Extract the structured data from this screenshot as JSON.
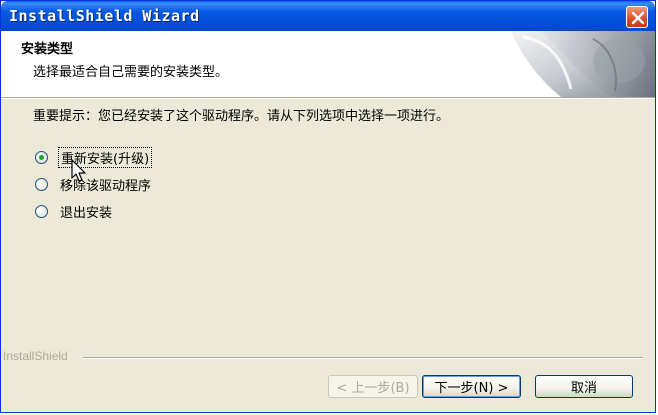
{
  "window": {
    "title": "InstallShield Wizard"
  },
  "header": {
    "title": "安装类型",
    "subtitle": "选择最适合自己需要的安装类型。"
  },
  "body": {
    "notice": "重要提示：您已经安装了这个驱动程序。请从下列选项中选择一项进行。",
    "options": [
      {
        "label": "重新安装(升级)",
        "selected": true
      },
      {
        "label": "移除该驱动程序",
        "selected": false
      },
      {
        "label": "退出安装",
        "selected": false
      }
    ]
  },
  "footer": {
    "brand": "InstallShield",
    "back_label": "< 上一步(B)",
    "next_label": "下一步(N) >",
    "cancel_label": "取消"
  },
  "icons": {
    "close": "close-icon",
    "cursor": "mouse-cursor-icon",
    "header_art": "installshield-graphic"
  },
  "colors": {
    "titlebar": "#0350d8",
    "close_button": "#d9532e",
    "dialog_bg": "#ece9d8",
    "radio_dot": "#21a121"
  }
}
